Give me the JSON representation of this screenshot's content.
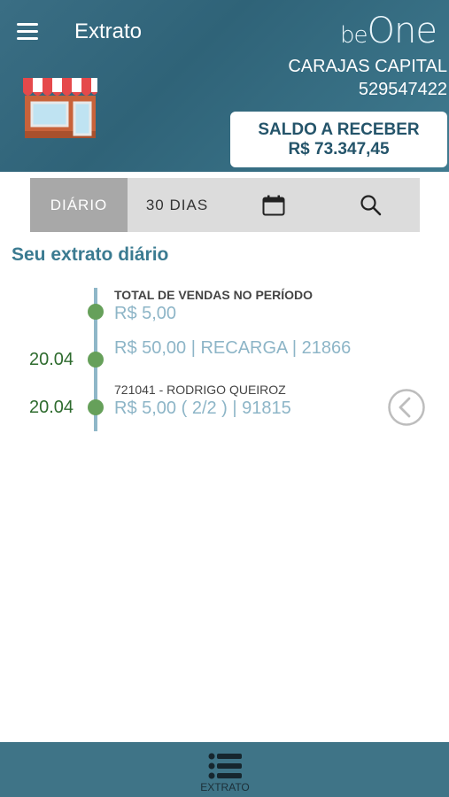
{
  "header": {
    "title": "Extrato",
    "logo_prefix": "be",
    "logo_suffix": "One",
    "company_name": "CARAJAS CAPITAL",
    "company_id": "529547422"
  },
  "balance": {
    "label": "SALDO A RECEBER",
    "value": "R$ 73.347,45"
  },
  "tabs": [
    {
      "label": "DIÁRIO",
      "active": true
    },
    {
      "label": "30 DIAS",
      "active": false
    }
  ],
  "section_title": "Seu extrato diário",
  "timeline": {
    "summary_label": "TOTAL DE VENDAS NO PERÍODO",
    "summary_value": "R$ 5,00",
    "entries": [
      {
        "date": "20.04",
        "caption": "",
        "text": "R$ 50,00 | RECARGA | 21866"
      },
      {
        "date": "20.04",
        "caption": "721041 - RODRIGO QUEIROZ",
        "text": "R$ 5,00 ( 2/2 ) | 91815"
      }
    ]
  },
  "bottom_nav": {
    "items": [
      {
        "label": "EXTRATO",
        "icon": "list-icon"
      }
    ]
  },
  "colors": {
    "header_bg": "#2f6378",
    "accent_text": "#3b7b91",
    "timeline_dot": "#66a05a",
    "entry_text": "#8db5c7"
  }
}
